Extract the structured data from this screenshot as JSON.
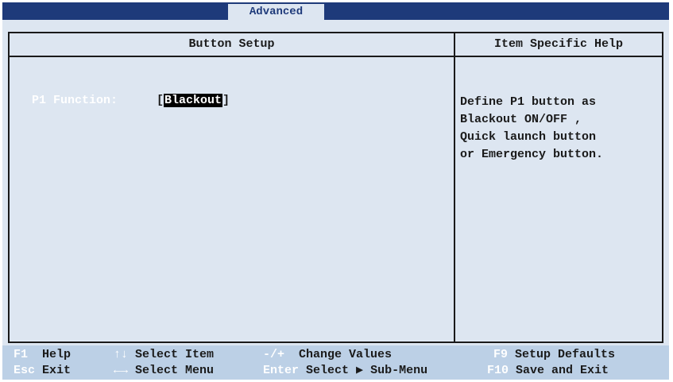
{
  "header": {
    "active_tab": "Advanced"
  },
  "panel": {
    "left_title": "Button Setup",
    "right_title": "Item Specific Help"
  },
  "setting": {
    "label": "P1 Function:",
    "bracket_open": "[",
    "value": "Blackout",
    "bracket_close": "]"
  },
  "help": {
    "lines": [
      "Define P1 button as",
      "Blackout ON/OFF ,",
      "Quick launch button",
      "or Emergency button."
    ]
  },
  "footer": {
    "row1": [
      {
        "key": "F1",
        "action": "Help"
      },
      {
        "key": "↑↓",
        "action": "Select Item"
      },
      {
        "key": "-/+",
        "action": "Change Values"
      },
      {
        "key": "F9",
        "action": "Setup Defaults"
      }
    ],
    "row2": [
      {
        "key": "Esc",
        "action": "Exit"
      },
      {
        "key": "←→",
        "action": "Select Menu"
      },
      {
        "key": "Enter",
        "action": "Select ▶ Sub-Menu"
      },
      {
        "key": "F10",
        "action": "Save and Exit"
      }
    ]
  },
  "colors": {
    "topbar": "#1e3a7a",
    "panel_bg": "#dde6f1",
    "footer_bg": "#bcd0e6",
    "highlight": "#000000"
  }
}
